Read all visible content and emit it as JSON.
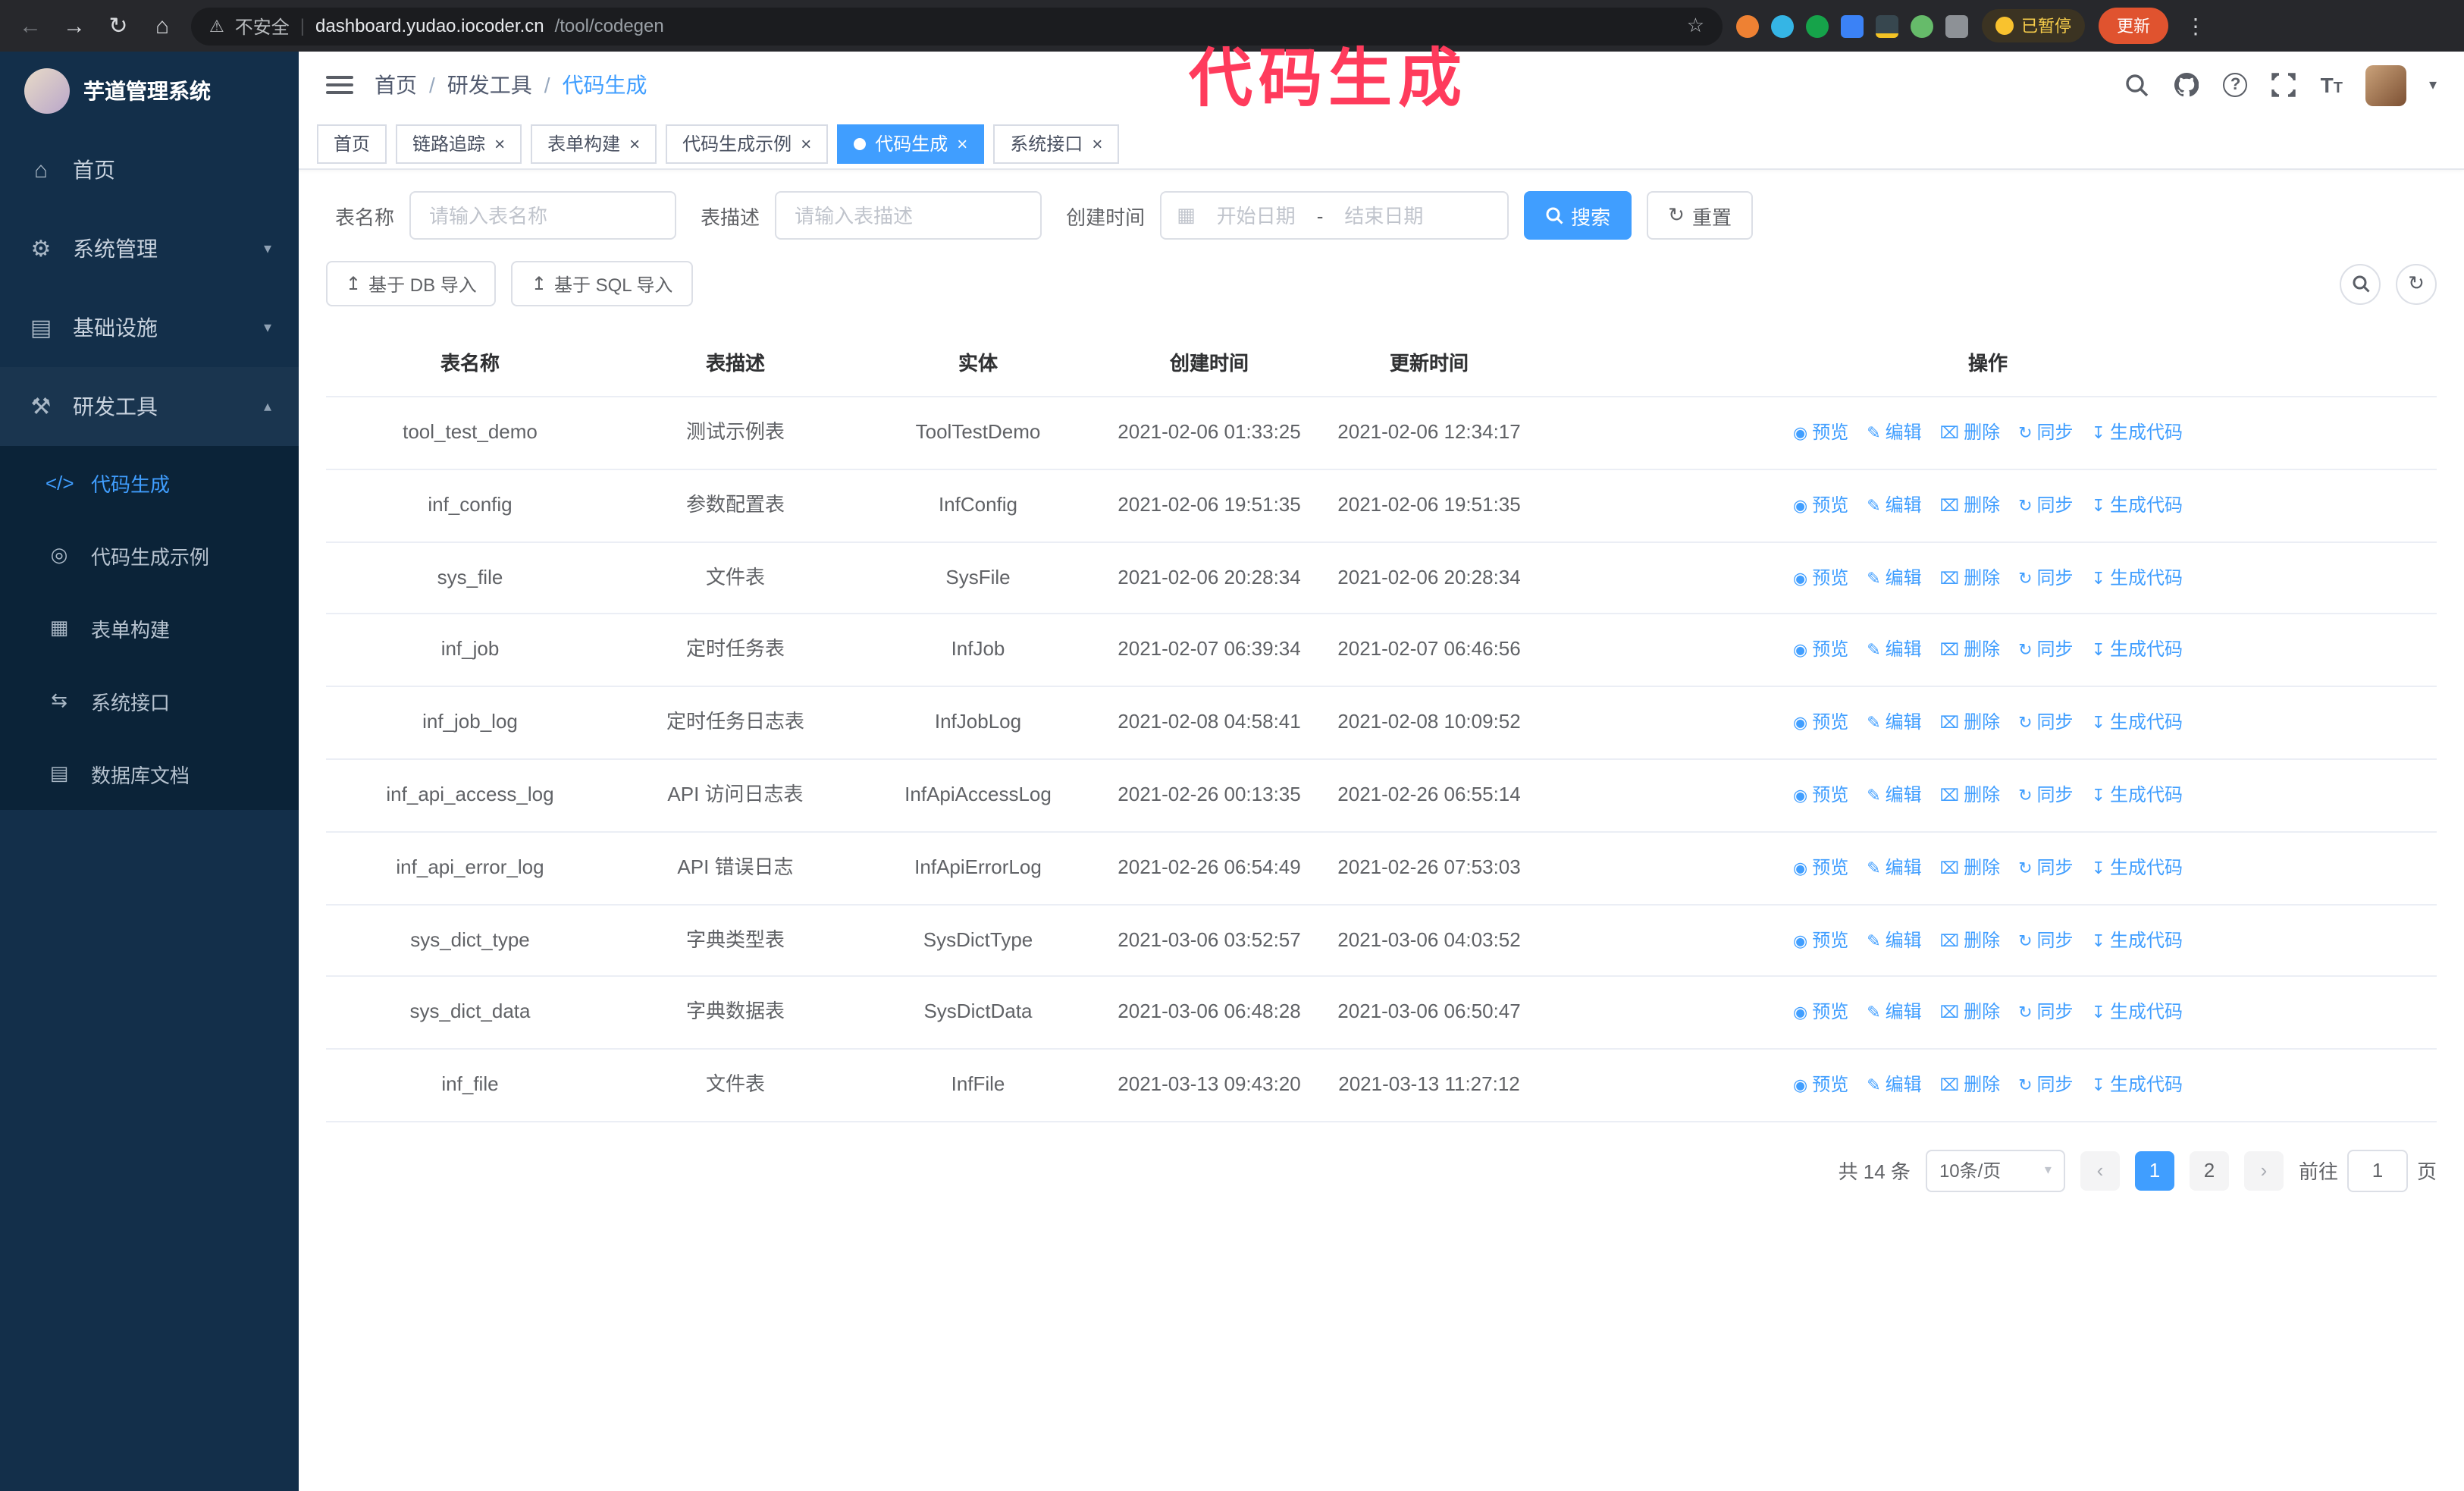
{
  "annotation": {
    "text": "代码生成"
  },
  "browser": {
    "security_label": "不安全",
    "url_host": "dashboard.yudao.iocoder.cn",
    "url_path": "/tool/codegen",
    "paused_badge": "已暂停",
    "update_button": "更新"
  },
  "icons": {
    "back": "←",
    "forward": "→",
    "reload": "↻",
    "home": "⌂",
    "warning": "⚠",
    "star": "☆",
    "kebab": "⋮",
    "divider": "|",
    "chevron_down": "▾",
    "chevron_up": "▴",
    "caret_down": "▾",
    "menu_home": "⌂",
    "menu_system": "⚙",
    "menu_infra": "▤",
    "menu_dev": "⚒",
    "sub_codegen": "</>",
    "sub_example": "◎",
    "sub_form": "▦",
    "sub_api": "⇆",
    "sub_db": "▤",
    "calendar": "▦",
    "reset": "↻",
    "upload": "↥",
    "help": "?",
    "eye": "◉",
    "edit": "✎",
    "delete": "⌧",
    "sync": "↻",
    "download": "↧",
    "prev": "‹",
    "next": "›",
    "close": "×",
    "font_big": "T",
    "font_small": "T",
    "breadcrumb_separator": "/"
  },
  "sidebar": {
    "logo_title": "芋道管理系统",
    "items": [
      {
        "label": "首页"
      },
      {
        "label": "系统管理"
      },
      {
        "label": "基础设施"
      },
      {
        "label": "研发工具"
      }
    ],
    "subitems": [
      {
        "label": "代码生成"
      },
      {
        "label": "代码生成示例"
      },
      {
        "label": "表单构建"
      },
      {
        "label": "系统接口"
      },
      {
        "label": "数据库文档"
      }
    ]
  },
  "header": {
    "breadcrumb": [
      "首页",
      "研发工具",
      "代码生成"
    ]
  },
  "tabs": [
    {
      "label": "首页"
    },
    {
      "label": "链路追踪"
    },
    {
      "label": "表单构建"
    },
    {
      "label": "代码生成示例"
    },
    {
      "label": "代码生成"
    },
    {
      "label": "系统接口"
    }
  ],
  "filters": {
    "table_name_label": "表名称",
    "table_name_placeholder": "请输入表名称",
    "table_desc_label": "表描述",
    "table_desc_placeholder": "请输入表描述",
    "create_time_label": "创建时间",
    "date_start_placeholder": "开始日期",
    "date_separator": "-",
    "date_end_placeholder": "结束日期",
    "search_label": "搜索",
    "reset_label": "重置"
  },
  "toolbar": {
    "import_db_label": "基于 DB 导入",
    "import_sql_label": "基于 SQL 导入"
  },
  "table": {
    "headers": [
      "表名称",
      "表描述",
      "实体",
      "创建时间",
      "更新时间",
      "操作"
    ],
    "actions": [
      "预览",
      "编辑",
      "删除",
      "同步",
      "生成代码"
    ],
    "rows": [
      {
        "name": "tool_test_demo",
        "desc": "测试示例表",
        "entity": "ToolTestDemo",
        "created": "2021-02-06 01:33:25",
        "updated": "2021-02-06 12:34:17"
      },
      {
        "name": "inf_config",
        "desc": "参数配置表",
        "entity": "InfConfig",
        "created": "2021-02-06 19:51:35",
        "updated": "2021-02-06 19:51:35"
      },
      {
        "name": "sys_file",
        "desc": "文件表",
        "entity": "SysFile",
        "created": "2021-02-06 20:28:34",
        "updated": "2021-02-06 20:28:34"
      },
      {
        "name": "inf_job",
        "desc": "定时任务表",
        "entity": "InfJob",
        "created": "2021-02-07 06:39:34",
        "updated": "2021-02-07 06:46:56"
      },
      {
        "name": "inf_job_log",
        "desc": "定时任务日志表",
        "entity": "InfJobLog",
        "created": "2021-02-08 04:58:41",
        "updated": "2021-02-08 10:09:52"
      },
      {
        "name": "inf_api_access_log",
        "desc": "API 访问日志表",
        "entity": "InfApiAccessLog",
        "created": "2021-02-26 00:13:35",
        "updated": "2021-02-26 06:55:14"
      },
      {
        "name": "inf_api_error_log",
        "desc": "API 错误日志",
        "entity": "InfApiErrorLog",
        "created": "2021-02-26 06:54:49",
        "updated": "2021-02-26 07:53:03"
      },
      {
        "name": "sys_dict_type",
        "desc": "字典类型表",
        "entity": "SysDictType",
        "created": "2021-03-06 03:52:57",
        "updated": "2021-03-06 04:03:52"
      },
      {
        "name": "sys_dict_data",
        "desc": "字典数据表",
        "entity": "SysDictData",
        "created": "2021-03-06 06:48:28",
        "updated": "2021-03-06 06:50:47"
      },
      {
        "name": "inf_file",
        "desc": "文件表",
        "entity": "InfFile",
        "created": "2021-03-13 09:43:20",
        "updated": "2021-03-13 11:27:12"
      }
    ]
  },
  "pagination": {
    "total_label": "共 14 条",
    "page_size_label": "10条/页",
    "page_1": "1",
    "page_2": "2",
    "goto_label": "前往",
    "goto_value": "1",
    "goto_suffix": "页"
  }
}
